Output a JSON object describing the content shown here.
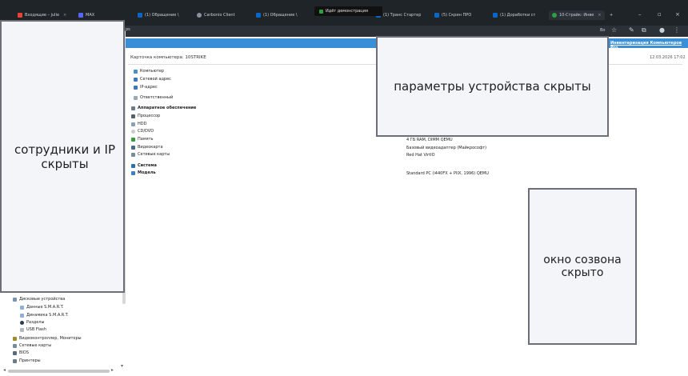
{
  "browser": {
    "tabs": [
      {
        "label": "Входящие – julie",
        "color": "#ea4335"
      },
      {
        "label": "MAX",
        "color": "#5865f2"
      },
      {
        "label": "(1) Обращение \\",
        "color": "#0a66c2"
      },
      {
        "label": "Carbonio Client",
        "color": "#8b949e"
      },
      {
        "label": "(1) Обращение \\",
        "color": "#0a66c2"
      },
      {
        "label": "(1) Транс Стартер",
        "color": "#0a66c2"
      },
      {
        "label": "(5) Скрин ПРО",
        "color": "#0a66c2"
      },
      {
        "label": "(1) Доработки ст",
        "color": "#0a66c2"
      },
      {
        "label": "10-Страйк: Инве",
        "color": "#2ea043"
      }
    ],
    "share_banner": "Идёт демонстрация",
    "new_tab": "+",
    "url_text": "рs",
    "toolbar_label": "Bo"
  },
  "app": {
    "header_link": "Инвентаризация Компьютеров Pro",
    "card_title": "Карточка компьютера: 10STRIKE",
    "card_date": "12.03.2026 17:02"
  },
  "properties": [
    {
      "label": "Компьютер",
      "icon": "computer-icon",
      "bold": false
    },
    {
      "label": "Сетевой адрес",
      "icon": "network-icon",
      "bold": false
    },
    {
      "label": "IP-адрес",
      "icon": "ip-icon",
      "bold": false
    },
    {
      "label": "Ответственный",
      "icon": "user-icon",
      "bold": false
    },
    {
      "label": "Аппаратное обеспечение",
      "icon": "hardware-icon",
      "bold": true
    },
    {
      "label": "Процессор",
      "icon": "cpu-icon",
      "bold": false
    },
    {
      "label": "HDD",
      "icon": "hdd-icon",
      "bold": false
    },
    {
      "label": "CD/DVD",
      "icon": "cd-icon",
      "bold": false
    },
    {
      "label": "Память",
      "icon": "ram-icon",
      "bold": false
    },
    {
      "label": "Видеокарта",
      "icon": "video-icon",
      "bold": false
    },
    {
      "label": "Сетевые карты",
      "icon": "nic-icon",
      "bold": false
    },
    {
      "label": "Система",
      "icon": "system-icon",
      "bold": true
    },
    {
      "label": "Модель",
      "icon": "model-icon",
      "bold": true
    }
  ],
  "values": {
    "memory": "4 ГБ RAM, DIMM QEMU",
    "video": "Базовый видеоадаптер (Майкрософт)",
    "network": "Red Hat VirtIO",
    "model": "Standard PC (i440FX + PIIX, 1996) QEMU"
  },
  "tree": [
    {
      "label": "Дисковые устройства",
      "icon": "disk-icon"
    },
    {
      "label": "Данные S.M.A.R.T.",
      "icon": "smart-icon"
    },
    {
      "label": "Динамика S.M.A.R.T.",
      "icon": "smart-dynamics-icon"
    },
    {
      "label": "Разделы",
      "icon": "partition-icon"
    },
    {
      "label": "USB Flash",
      "icon": "usb-icon"
    },
    {
      "label": "Видеоконтроллер, Мониторы",
      "icon": "monitor-icon"
    },
    {
      "label": "Сетевые карты",
      "icon": "nic-icon"
    },
    {
      "label": "BIOS",
      "icon": "bios-icon"
    },
    {
      "label": "Принтеры",
      "icon": "printer-icon"
    }
  ],
  "redactions": {
    "left": "сотрудники и IP скрыты",
    "params": "параметры устройства скрыты",
    "call": "окно созвона скрыто"
  }
}
